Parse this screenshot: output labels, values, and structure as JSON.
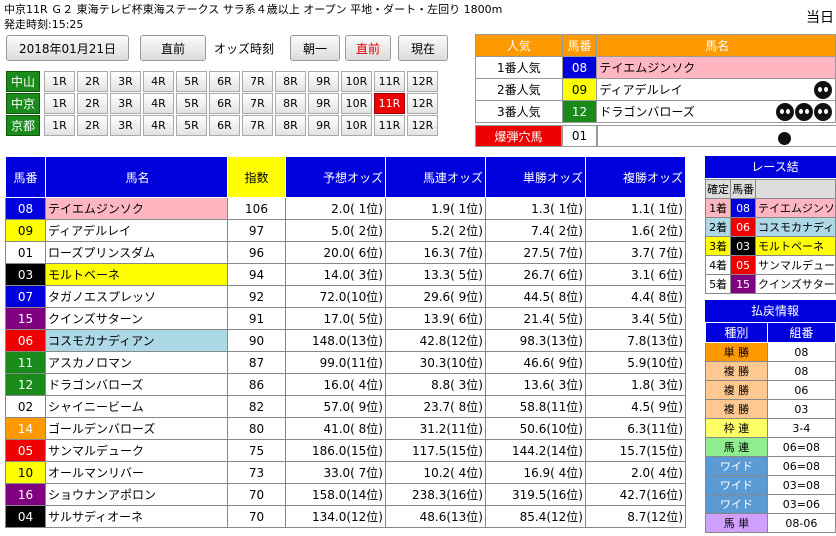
{
  "header": {
    "race_info": "中京11R Ｇ２ 東海テレビ杯東海ステークス サラ系４歳以上 オープン 平地・ダート・左回り 1800m",
    "post_time": "発走時刻:15:25",
    "today_label": "当日"
  },
  "controls": {
    "date": "2018年01月21日",
    "prev_label": "直前",
    "odds_time_label": "オッズ時刻",
    "odds_times": [
      {
        "label": "朝一",
        "selected": false
      },
      {
        "label": "直前",
        "selected": true
      },
      {
        "label": "現在",
        "selected": false
      }
    ]
  },
  "venues": [
    {
      "name": "中山",
      "races": [
        "1R",
        "2R",
        "3R",
        "4R",
        "5R",
        "6R",
        "7R",
        "8R",
        "9R",
        "10R",
        "11R",
        "12R"
      ],
      "selected": null
    },
    {
      "name": "中京",
      "races": [
        "1R",
        "2R",
        "3R",
        "4R",
        "5R",
        "6R",
        "7R",
        "8R",
        "9R",
        "10R",
        "11R",
        "12R"
      ],
      "selected": "11R"
    },
    {
      "name": "京都",
      "races": [
        "1R",
        "2R",
        "3R",
        "4R",
        "5R",
        "6R",
        "7R",
        "8R",
        "9R",
        "10R",
        "11R",
        "12R"
      ],
      "selected": null
    }
  ],
  "popularity": {
    "headers": [
      "人気",
      "馬番",
      "馬名"
    ],
    "rows": [
      {
        "rank": "1番人気",
        "no": "08",
        "name": "テイエムジンソク",
        "no_bg": "#0000dd",
        "no_fg": "#ffffff",
        "name_bg": "#ffb6c1",
        "skulls": 0
      },
      {
        "rank": "2番人気",
        "no": "09",
        "name": "ディアデルレイ",
        "no_bg": "#ffff00",
        "no_fg": "#000000",
        "name_bg": "#ffffff",
        "skulls": 1
      },
      {
        "rank": "3番人気",
        "no": "12",
        "name": "ドラゴンバローズ",
        "no_bg": "#1a8a1a",
        "no_fg": "#ffffff",
        "name_bg": "#ffffff",
        "skulls": 3
      }
    ],
    "dark_horse": {
      "label": "爆弾穴馬",
      "no": "01"
    }
  },
  "main_table": {
    "headers": [
      "馬番",
      "馬名",
      "指数",
      "予想オッズ",
      "馬連オッズ",
      "単勝オッズ",
      "複勝オッズ"
    ],
    "rows": [
      {
        "no": "08",
        "name": "テイエムジンソク",
        "idx": "106",
        "o1": "2.0( 1位)",
        "o2": "1.9( 1位)",
        "o3": "1.3( 1位)",
        "o4": "1.1( 1位)",
        "no_bg": "#0000dd",
        "no_fg": "#ffffff",
        "name_bg": "#ffb6c1"
      },
      {
        "no": "09",
        "name": "ディアデルレイ",
        "idx": "97",
        "o1": "5.0( 2位)",
        "o2": "5.2( 2位)",
        "o3": "7.4( 2位)",
        "o4": "1.6( 2位)",
        "no_bg": "#ffff00",
        "no_fg": "#000000",
        "name_bg": "#ffffff"
      },
      {
        "no": "01",
        "name": "ローズプリンスダム",
        "idx": "96",
        "o1": "20.0( 6位)",
        "o2": "16.3( 7位)",
        "o3": "27.5( 7位)",
        "o4": "3.7( 7位)",
        "no_bg": "#ffffff",
        "no_fg": "#000000",
        "name_bg": "#ffffff"
      },
      {
        "no": "03",
        "name": "モルトベーネ",
        "idx": "94",
        "o1": "14.0( 3位)",
        "o2": "13.3( 5位)",
        "o3": "26.7( 6位)",
        "o4": "3.1( 6位)",
        "no_bg": "#000000",
        "no_fg": "#ffffff",
        "name_bg": "#ffff00"
      },
      {
        "no": "07",
        "name": "タガノエスプレッソ",
        "idx": "92",
        "o1": "72.0(10位)",
        "o2": "29.6( 9位)",
        "o3": "44.5( 8位)",
        "o4": "4.4( 8位)",
        "no_bg": "#0000dd",
        "no_fg": "#ffffff",
        "name_bg": "#ffffff"
      },
      {
        "no": "15",
        "name": "クインズサターン",
        "idx": "91",
        "o1": "17.0( 5位)",
        "o2": "13.9( 6位)",
        "o3": "21.4( 5位)",
        "o4": "3.4( 5位)",
        "no_bg": "#800080",
        "no_fg": "#ffffff",
        "name_bg": "#ffffff"
      },
      {
        "no": "06",
        "name": "コスモカナディアン",
        "idx": "90",
        "o1": "148.0(13位)",
        "o2": "42.8(12位)",
        "o3": "98.3(13位)",
        "o4": "7.8(13位)",
        "no_bg": "#ee0000",
        "no_fg": "#ffffff",
        "name_bg": "#add8e6"
      },
      {
        "no": "11",
        "name": "アスカノロマン",
        "idx": "87",
        "o1": "99.0(11位)",
        "o2": "30.3(10位)",
        "o3": "46.6( 9位)",
        "o4": "5.9(10位)",
        "no_bg": "#1a8a1a",
        "no_fg": "#ffffff",
        "name_bg": "#ffffff"
      },
      {
        "no": "12",
        "name": "ドラゴンバローズ",
        "idx": "86",
        "o1": "16.0( 4位)",
        "o2": "8.8( 3位)",
        "o3": "13.6( 3位)",
        "o4": "1.8( 3位)",
        "no_bg": "#1a8a1a",
        "no_fg": "#ffffff",
        "name_bg": "#ffffff"
      },
      {
        "no": "02",
        "name": "シャイニービーム",
        "idx": "82",
        "o1": "57.0( 9位)",
        "o2": "23.7( 8位)",
        "o3": "58.8(11位)",
        "o4": "4.5( 9位)",
        "no_bg": "#ffffff",
        "no_fg": "#000000",
        "name_bg": "#ffffff"
      },
      {
        "no": "14",
        "name": "ゴールデンバローズ",
        "idx": "80",
        "o1": "41.0( 8位)",
        "o2": "31.2(11位)",
        "o3": "50.6(10位)",
        "o4": "6.3(11位)",
        "no_bg": "#ff9900",
        "no_fg": "#ffffff",
        "name_bg": "#ffffff"
      },
      {
        "no": "05",
        "name": "サンマルデューク",
        "idx": "75",
        "o1": "186.0(15位)",
        "o2": "117.5(15位)",
        "o3": "144.2(14位)",
        "o4": "15.7(15位)",
        "no_bg": "#ee0000",
        "no_fg": "#ffffff",
        "name_bg": "#ffffff"
      },
      {
        "no": "10",
        "name": "オールマンリバー",
        "idx": "73",
        "o1": "33.0( 7位)",
        "o2": "10.2( 4位)",
        "o3": "16.9( 4位)",
        "o4": "2.0( 4位)",
        "no_bg": "#ffff00",
        "no_fg": "#000000",
        "name_bg": "#ffffff"
      },
      {
        "no": "16",
        "name": "ショウナンアポロン",
        "idx": "70",
        "o1": "158.0(14位)",
        "o2": "238.3(16位)",
        "o3": "319.5(16位)",
        "o4": "42.7(16位)",
        "no_bg": "#800080",
        "no_fg": "#ffffff",
        "name_bg": "#ffffff"
      },
      {
        "no": "04",
        "name": "サルサディオーネ",
        "idx": "70",
        "o1": "134.0(12位)",
        "o2": "48.6(13位)",
        "o3": "85.4(12位)",
        "o4": "8.7(12位)",
        "no_bg": "#000000",
        "no_fg": "#ffffff",
        "name_bg": "#ffffff"
      }
    ]
  },
  "result": {
    "title": "レース結",
    "headers": [
      "確定",
      "馬番",
      ""
    ],
    "rows": [
      {
        "pos": "1着",
        "no": "08",
        "name": "テイエムジンソ",
        "pos_bg": "#ffb6c1",
        "no_bg": "#0000dd",
        "no_fg": "#ffffff",
        "name_bg": "#ffb6c1"
      },
      {
        "pos": "2着",
        "no": "06",
        "name": "コスモカナディ",
        "pos_bg": "#add8e6",
        "no_bg": "#ee0000",
        "no_fg": "#ffffff",
        "name_bg": "#add8e6"
      },
      {
        "pos": "3着",
        "no": "03",
        "name": "モルトベーネ",
        "pos_bg": "#ffff00",
        "no_bg": "#000000",
        "no_fg": "#ffffff",
        "name_bg": "#ffff00"
      },
      {
        "pos": "4着",
        "no": "05",
        "name": "サンマルデュー",
        "pos_bg": "#ffffff",
        "no_bg": "#ee0000",
        "no_fg": "#ffffff",
        "name_bg": "#ffffff"
      },
      {
        "pos": "5着",
        "no": "15",
        "name": "クインズサター",
        "pos_bg": "#ffffff",
        "no_bg": "#800080",
        "no_fg": "#ffffff",
        "name_bg": "#ffffff"
      }
    ]
  },
  "payout": {
    "title": "払戻情報",
    "headers": [
      "種別",
      "組番"
    ],
    "rows": [
      {
        "type": "単 勝",
        "combo": "08",
        "bg": "#ff9900"
      },
      {
        "type": "複 勝",
        "combo": "08",
        "bg": "#ffc890"
      },
      {
        "type": "複 勝",
        "combo": "06",
        "bg": "#ffc890"
      },
      {
        "type": "複 勝",
        "combo": "03",
        "bg": "#ffc890"
      },
      {
        "type": "枠 連",
        "combo": "3-4",
        "bg": "#ffff66"
      },
      {
        "type": "馬 連",
        "combo": "06=08",
        "bg": "#90ee90"
      },
      {
        "type": "ワイド",
        "combo": "06=08",
        "bg": "#5b9bd5"
      },
      {
        "type": "ワイド",
        "combo": "03=08",
        "bg": "#5b9bd5"
      },
      {
        "type": "ワイド",
        "combo": "03=06",
        "bg": "#5b9bd5"
      },
      {
        "type": "馬 単",
        "combo": "08-06",
        "bg": "#d0a0ff"
      }
    ]
  }
}
